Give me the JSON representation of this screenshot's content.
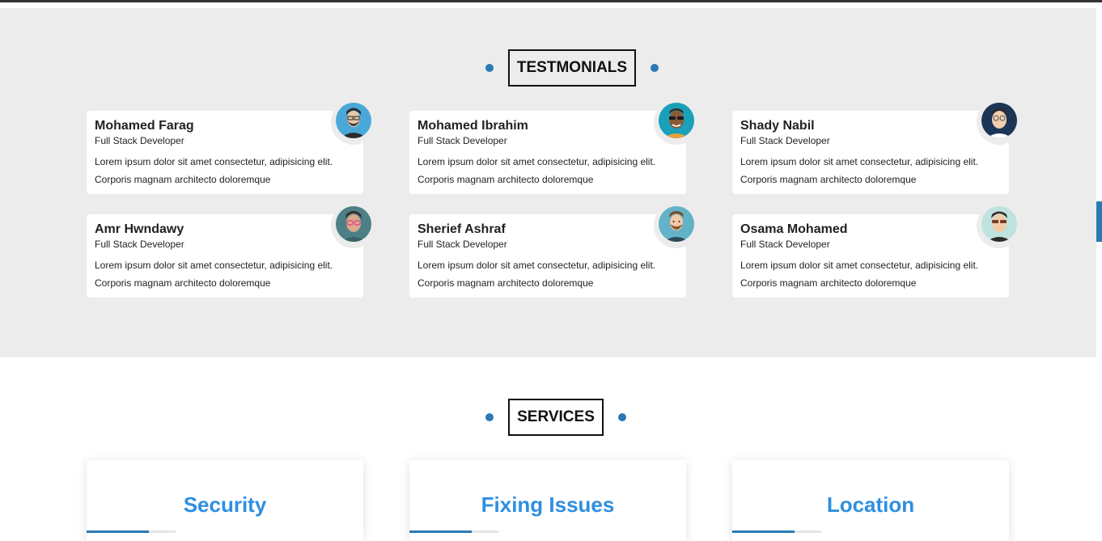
{
  "testimonials": {
    "title": "TESTMONIALS",
    "cards": [
      {
        "name": "Mohamed Farag",
        "role": "Full Stack Developer",
        "line1": "Lorem ipsum dolor sit amet consectetur, adipisicing elit.",
        "line2": "Corporis magnam architecto doloremque",
        "avatar_bg": "#4aa8d8",
        "avatar_icon": "avatar-man-beard-glasses-icon"
      },
      {
        "name": "Mohamed Ibrahim",
        "role": "Full Stack Developer",
        "line1": "Lorem ipsum dolor sit amet consectetur, adipisicing elit.",
        "line2": "Corporis magnam architecto doloremque",
        "avatar_bg": "#1aa0b8",
        "avatar_icon": "avatar-man-sunglasses-icon"
      },
      {
        "name": "Shady Nabil",
        "role": "Full Stack Developer",
        "line1": "Lorem ipsum dolor sit amet consectetur, adipisicing elit.",
        "line2": "Corporis magnam architecto doloremque",
        "avatar_bg": "#1c3556",
        "avatar_icon": "avatar-man-glasses-icon"
      },
      {
        "name": "Amr Hwndawy",
        "role": "Full Stack Developer",
        "line1": "Lorem ipsum dolor sit amet consectetur, adipisicing elit.",
        "line2": "Corporis magnam architecto doloremque",
        "avatar_bg": "#4d7f86",
        "avatar_icon": "avatar-man-pink-glasses-icon"
      },
      {
        "name": "Sherief Ashraf",
        "role": "Full Stack Developer",
        "line1": "Lorem ipsum dolor sit amet consectetur, adipisicing elit.",
        "line2": "Corporis magnam architecto doloremque",
        "avatar_bg": "#63b3c8",
        "avatar_icon": "avatar-man-beard-icon"
      },
      {
        "name": "Osama Mohamed",
        "role": "Full Stack Developer",
        "line1": "Lorem ipsum dolor sit amet consectetur, adipisicing elit.",
        "line2": "Corporis magnam architecto doloremque",
        "avatar_bg": "#bfe3de",
        "avatar_icon": "avatar-man-shades-icon"
      }
    ]
  },
  "services": {
    "title": "SERVICES",
    "cards": [
      {
        "title": "Security"
      },
      {
        "title": "Fixing Issues"
      },
      {
        "title": "Location"
      }
    ]
  },
  "colors": {
    "accent": "#2a7ab5",
    "service_title": "#2e8fe0",
    "section_bg": "#ececec"
  }
}
